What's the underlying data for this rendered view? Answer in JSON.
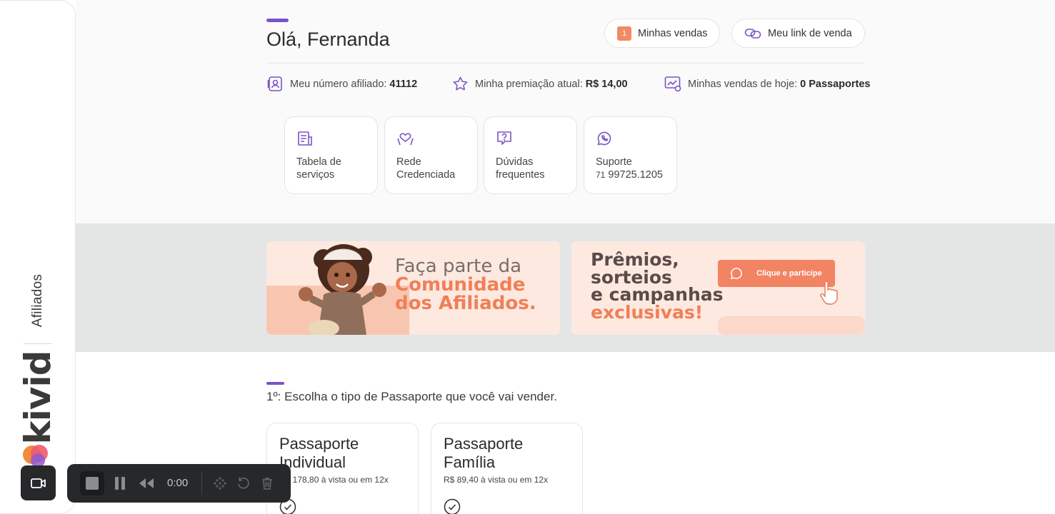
{
  "sidebar": {
    "label": "Afiliados",
    "brand": "kivid"
  },
  "header": {
    "greeting": "Olá, Fernanda",
    "sales_button": {
      "badge": "1",
      "label": "Minhas vendas"
    },
    "link_button": {
      "label": "Meu link de venda"
    }
  },
  "info": {
    "affiliate": {
      "label": "Meu número afiliado:",
      "value": "41112"
    },
    "award": {
      "label": "Minha premiação atual:",
      "value": "R$ 14,00"
    },
    "today": {
      "label": "Minhas vendas de hoje:",
      "value": "0 Passaportes"
    }
  },
  "cards": [
    {
      "line1": "Tabela de",
      "line2": "serviços",
      "icon": "table-icon"
    },
    {
      "line1": "Rede",
      "line2": "Credenciada",
      "icon": "handshake-icon"
    },
    {
      "line1": "Dúvidas",
      "line2": "frequentes",
      "icon": "question-icon"
    },
    {
      "line1": "Suporte",
      "line2_prefix": "71",
      "line2": "99725.1205",
      "icon": "whatsapp-icon"
    }
  ],
  "banners": {
    "community": {
      "line1": "Faça parte da",
      "line2": "Comunidade",
      "line3": "dos Afiliados."
    },
    "prizes": {
      "line1": "Prêmios,",
      "line2": "sorteios",
      "line3": "e campanhas",
      "line4": "exclusivas!",
      "cta": "Clique e participe"
    }
  },
  "step": {
    "text": "1º: Escolha o tipo de Passaporte que você vai vender."
  },
  "passports": [
    {
      "title": "Passaporte Individual",
      "price": "R$ 178,80 à vista ou em 12x"
    },
    {
      "title": "Passaporte Família",
      "price": "R$ 89,40 à vista ou em 12x"
    }
  ],
  "recorder": {
    "time": "0:00"
  },
  "colors": {
    "accent": "#7a52c7",
    "orange": "#f18b63",
    "band": "#e4e6e6"
  }
}
